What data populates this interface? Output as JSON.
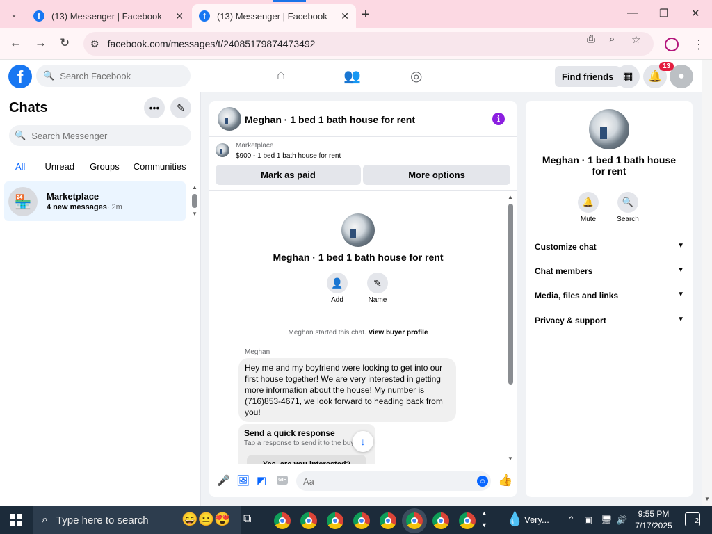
{
  "browser": {
    "tabs": [
      {
        "title": "(13) Messenger | Facebook",
        "active": false
      },
      {
        "title": "(13) Messenger | Facebook",
        "active": true
      }
    ],
    "url": "facebook.com/messages/t/24085179874473492"
  },
  "fb": {
    "search_placeholder": "Search Facebook",
    "find_friends": "Find friends",
    "notification_count": "13"
  },
  "sidebar": {
    "title": "Chats",
    "search_placeholder": "Search Messenger",
    "filters": [
      "All",
      "Unread",
      "Groups",
      "Communities"
    ],
    "active_filter": "All",
    "chats": [
      {
        "name": "Marketplace",
        "preview": "4 new messages",
        "time": "· 2m"
      }
    ]
  },
  "conversation": {
    "title": "Meghan · 1 bed 1 bath house for rent",
    "marketplace_label": "Marketplace",
    "listing": "$900 - 1 bed 1 bath house for rent",
    "mark_as_paid": "Mark as paid",
    "more_options": "More options",
    "intro_title": "Meghan · 1 bed 1 bath house for rent",
    "add_label": "Add",
    "name_label": "Name",
    "system_text": "Meghan started this chat.",
    "view_profile": "View buyer profile",
    "sender": "Meghan",
    "message": "Hey me and my boyfriend were looking to get into our first house together! We are very interested in getting more information about the house! My number is (716)853-4671, we look forward to heading back from you!",
    "quick_title": "Send a quick response",
    "quick_sub": "Tap a response to send it to the buyer",
    "quick_option": "Yes, are you interested?",
    "composer_placeholder": "Aa"
  },
  "right_panel": {
    "title": "Meghan · 1 bed 1 bath house for rent",
    "mute": "Mute",
    "search": "Search",
    "sections": [
      "Customize chat",
      "Chat members",
      "Media, files and links",
      "Privacy & support"
    ]
  },
  "taskbar": {
    "search_text": "Type here to search",
    "weather": "Very...",
    "time": "9:55 PM",
    "date": "7/17/2025",
    "notifications": "2"
  },
  "colors": {
    "accent": "#0866ff",
    "fb_blue": "#1877f2",
    "active_chat_bg": "#ebf5ff",
    "badge_red": "#e41e3f",
    "info_purple": "#8b1ee0"
  }
}
